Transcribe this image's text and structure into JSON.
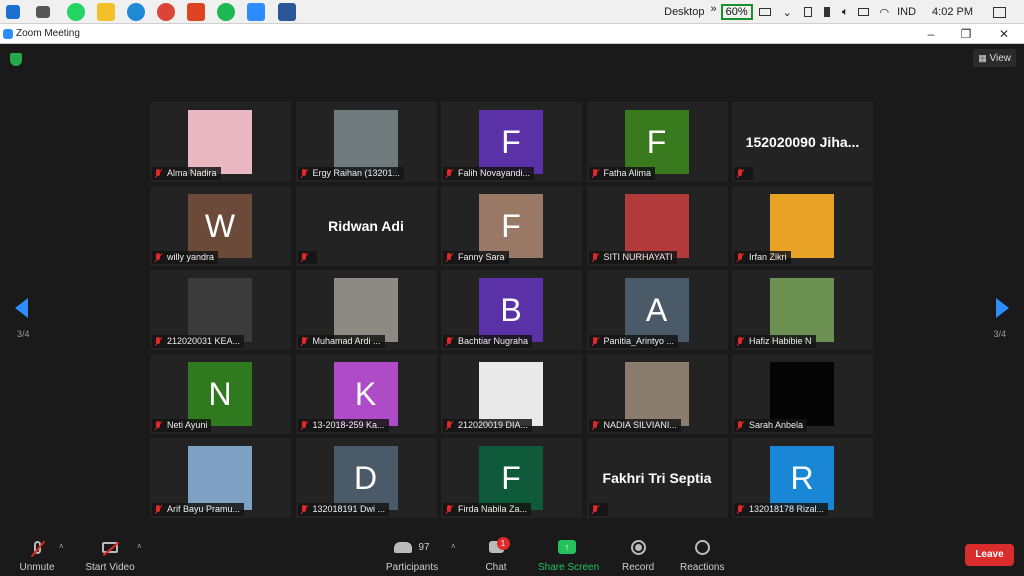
{
  "taskbar": {
    "desktop_label": "Desktop",
    "battery": "60%",
    "lang": "IND",
    "time": "4:02 PM",
    "chevrons": "»"
  },
  "window": {
    "title": "Zoom Meeting"
  },
  "meeting": {
    "view_label": "View",
    "page_left": "3/4",
    "page_right": "3/4",
    "participants": [
      {
        "name": "Alma Nadira",
        "type": "photo",
        "color": "#e9b8c0"
      },
      {
        "name": "Ergy Raihan (13201...",
        "type": "photo",
        "color": "#6f7a7d"
      },
      {
        "name": "Falih Novayandi...",
        "type": "letter",
        "letter": "F",
        "color": "#5b31a8"
      },
      {
        "name": "Fatha Alima",
        "type": "letter",
        "letter": "F",
        "color": "#3a7a1f"
      },
      {
        "name": "",
        "type": "bigname",
        "bigname": "152020090  Jiha..."
      },
      {
        "name": "willy yandra",
        "type": "letter",
        "letter": "W",
        "color": "#6b4a3a"
      },
      {
        "name": "",
        "type": "bigname",
        "bigname": "Ridwan Adi"
      },
      {
        "name": "Fanny Sara",
        "type": "letter",
        "letter": "F",
        "color": "#9a7866"
      },
      {
        "name": "SITI NURHAYATI",
        "type": "photo",
        "color": "#b23a3a"
      },
      {
        "name": "Irfan Zikri",
        "type": "photo",
        "color": "#e8a326"
      },
      {
        "name": "212020031 KEA...",
        "type": "photo",
        "color": "#3b3b3b"
      },
      {
        "name": "Muhamad Ardi ...",
        "type": "photo",
        "color": "#8c8a83"
      },
      {
        "name": "Bachtiar Nugraha",
        "type": "letter",
        "letter": "B",
        "color": "#5b31a8"
      },
      {
        "name": "Panitia_Arintyo ...",
        "type": "letter",
        "letter": "A",
        "color": "#4a5a68"
      },
      {
        "name": "Hafiz Habibie N",
        "type": "photo",
        "color": "#6c8f52"
      },
      {
        "name": "Neti Ayuni",
        "type": "letter",
        "letter": "N",
        "color": "#2f7a1e"
      },
      {
        "name": "13-2018-259 Ka...",
        "type": "letter",
        "letter": "K",
        "color": "#b04bc7"
      },
      {
        "name": "212020019 DIA...",
        "type": "photo",
        "color": "#e9e9e9"
      },
      {
        "name": "NADIA SILVIANI...",
        "type": "photo",
        "color": "#8a7d70"
      },
      {
        "name": "Sarah Anbela",
        "type": "photo",
        "color": "#050505"
      },
      {
        "name": "Arif Bayu Pramu...",
        "type": "photo",
        "color": "#7fa2c4"
      },
      {
        "name": "132018191 Dwi ...",
        "type": "letter",
        "letter": "D",
        "color": "#4a5a68"
      },
      {
        "name": "Firda Nabila Za...",
        "type": "letter",
        "letter": "F",
        "color": "#0f5a3a"
      },
      {
        "name": "",
        "type": "bigname",
        "bigname": "Fakhri Tri Septia"
      },
      {
        "name": "132018178 Rizal...",
        "type": "letter",
        "letter": "R",
        "color": "#1a86d6"
      }
    ]
  },
  "toolbar": {
    "unmute": "Unmute",
    "start_video": "Start Video",
    "participants_label": "Participants",
    "participants_count": "97",
    "chat": "Chat",
    "chat_badge": "1",
    "share_screen": "Share Screen",
    "record": "Record",
    "reactions": "Reactions",
    "leave": "Leave"
  },
  "colors": {
    "accent": "#2d8cff",
    "share_green": "#23c25d",
    "leave_red": "#d92c2c"
  }
}
